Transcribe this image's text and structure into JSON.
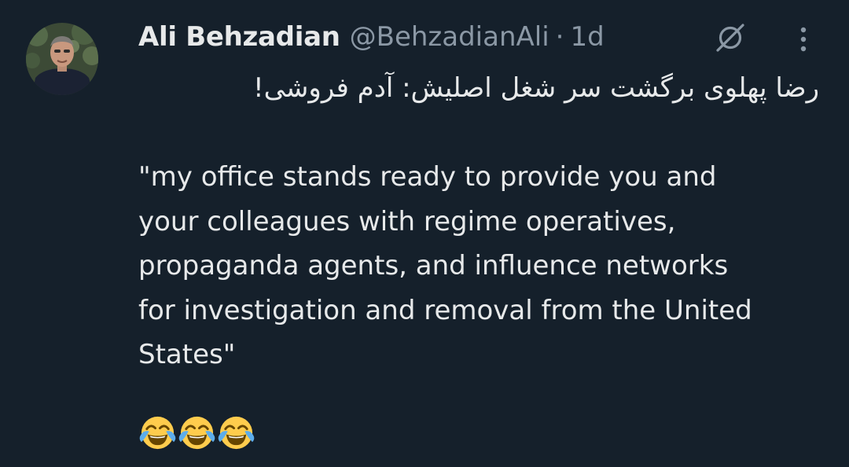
{
  "tweet": {
    "author_name": "Ali Behzadian",
    "author_handle": "@BehzadianAli",
    "separator": "·",
    "timestamp": "1d",
    "text_persian": "رضا پهلوی برگشت سر شغل اصلیش: آدم فروشی!",
    "quote_lines": [
      "\"my office stands ready to provide you and",
      "your colleagues with regime operatives,",
      "propaganda agents, and influence networks",
      "for investigation and removal from the United",
      "States\""
    ],
    "emojis": [
      "face-with-tears-of-joy",
      "face-with-tears-of-joy",
      "face-with-tears-of-joy"
    ]
  },
  "icons": {
    "grok": "grok-icon",
    "more": "more-icon"
  },
  "colors": {
    "background": "#15202b",
    "primary_text": "#e7e9ea",
    "secondary_text": "#8b98a5"
  }
}
